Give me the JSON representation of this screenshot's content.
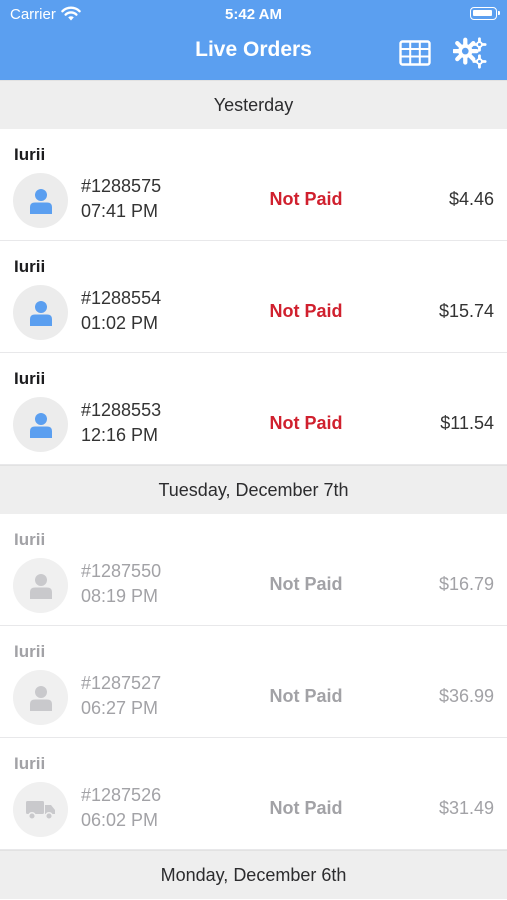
{
  "status_bar": {
    "carrier": "Carrier",
    "time": "5:42 AM"
  },
  "nav": {
    "title": "Live Orders",
    "grid_icon": "table-grid-icon",
    "settings_icon": "gears-icon",
    "color": "#5b9ff0"
  },
  "sections": [
    {
      "title": "Yesterday",
      "orders": [
        {
          "name": "Iurii",
          "number": "#1288575",
          "time": "07:41 PM",
          "status": "Not Paid",
          "amount": "$4.46",
          "icon": "person-icon",
          "active": true
        },
        {
          "name": "Iurii",
          "number": "#1288554",
          "time": "01:02 PM",
          "status": "Not Paid",
          "amount": "$15.74",
          "icon": "person-icon",
          "active": true
        },
        {
          "name": "Iurii",
          "number": "#1288553",
          "time": "12:16 PM",
          "status": "Not Paid",
          "amount": "$11.54",
          "icon": "person-icon",
          "active": true
        }
      ]
    },
    {
      "title": "Tuesday, December 7th",
      "orders": [
        {
          "name": "Iurii",
          "number": "#1287550",
          "time": "08:19 PM",
          "status": "Not Paid",
          "amount": "$16.79",
          "icon": "person-icon",
          "active": false
        },
        {
          "name": "Iurii",
          "number": "#1287527",
          "time": "06:27 PM",
          "status": "Not Paid",
          "amount": "$36.99",
          "icon": "person-icon",
          "active": false
        },
        {
          "name": "Iurii",
          "number": "#1287526",
          "time": "06:02 PM",
          "status": "Not Paid",
          "amount": "$31.49",
          "icon": "delivery-truck-icon",
          "active": false
        }
      ]
    },
    {
      "title": "Monday, December 6th",
      "orders": []
    }
  ],
  "colors": {
    "not_paid": "#d0202e",
    "avatar_active": "#5b9ff0",
    "avatar_inactive": "#c9c9cc"
  }
}
